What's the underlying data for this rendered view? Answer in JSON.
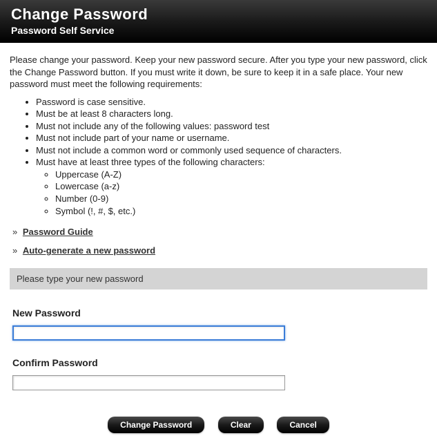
{
  "header": {
    "title": "Change Password",
    "subtitle": "Password Self Service"
  },
  "intro": "Please change your password. Keep your new password secure. After you type your new password, click the Change Password button. If you must write it down, be sure to keep it in a safe place. Your new password must meet the following requirements:",
  "requirements": [
    "Password is case sensitive.",
    "Must be at least 8 characters long.",
    "Must not include any of the following values: password test",
    "Must not include part of your name or username.",
    "Must not include a common word or commonly used sequence of characters.",
    "Must have at least three types of the following characters:"
  ],
  "sub_requirements": [
    "Uppercase (A-Z)",
    "Lowercase (a-z)",
    "Number (0-9)",
    "Symbol (!, #, $, etc.)"
  ],
  "links": {
    "guide": "Password Guide",
    "autogen": "Auto-generate a new password"
  },
  "prompt": "Please type your new password",
  "fields": {
    "new_password_label": "New Password",
    "confirm_password_label": "Confirm Password"
  },
  "buttons": {
    "change": "Change Password",
    "clear": "Clear",
    "cancel": "Cancel"
  }
}
